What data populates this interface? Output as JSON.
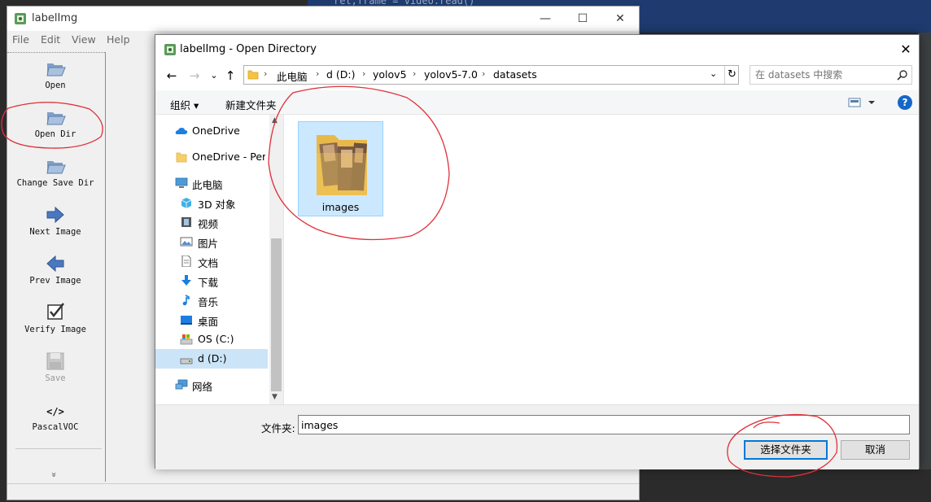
{
  "background": {
    "code_line": "ret,frame = video.read()"
  },
  "main_window": {
    "title": "labelImg",
    "controls": {
      "minimize": "—",
      "maximize": "☐",
      "close": "✕"
    },
    "menu": [
      "File",
      "Edit",
      "View",
      "Help"
    ],
    "toolbar": [
      {
        "label": "Open",
        "icon": "folder-open-icon"
      },
      {
        "label": "Open Dir",
        "icon": "folder-open-icon"
      },
      {
        "label": "Change Save Dir",
        "icon": "folder-open-icon"
      },
      {
        "label": "Next Image",
        "icon": "arrow-right-icon"
      },
      {
        "label": "Prev Image",
        "icon": "arrow-left-icon"
      },
      {
        "label": "Verify Image",
        "icon": "checkbox-icon"
      },
      {
        "label": "Save",
        "icon": "floppy-icon"
      },
      {
        "label": "PascalVOC",
        "icon": "code-icon"
      }
    ],
    "toolbar_expand": "»"
  },
  "dialog": {
    "title": "labelImg - Open Directory",
    "close": "✕",
    "nav": {
      "back": "←",
      "forward": "→",
      "recent": "⌄",
      "up": "↑"
    },
    "breadcrumb": [
      "此电脑",
      "d (D:)",
      "yolov5",
      "yolov5-7.0",
      "datasets"
    ],
    "breadcrumb_sep": "›",
    "address_dropdown": "⌄",
    "refresh": "↻",
    "search_placeholder": "在 datasets 中搜索",
    "commands": {
      "organize": "组织 ▾",
      "new_folder": "新建文件夹",
      "help": "?"
    },
    "nav_pane": [
      {
        "label": "OneDrive",
        "icon": "cloud-icon",
        "level": 1
      },
      {
        "label": "OneDrive - Personal",
        "icon": "folder-icon",
        "level": 1
      },
      {
        "label": "此电脑",
        "icon": "computer-icon",
        "level": 1
      },
      {
        "label": "3D 对象",
        "icon": "cube-icon",
        "level": 2
      },
      {
        "label": "视频",
        "icon": "film-icon",
        "level": 2
      },
      {
        "label": "图片",
        "icon": "picture-icon",
        "level": 2
      },
      {
        "label": "文档",
        "icon": "document-icon",
        "level": 2
      },
      {
        "label": "下载",
        "icon": "download-icon",
        "level": 2
      },
      {
        "label": "音乐",
        "icon": "music-icon",
        "level": 2
      },
      {
        "label": "桌面",
        "icon": "desktop-icon",
        "level": 2
      },
      {
        "label": "OS (C:)",
        "icon": "drive-c-icon",
        "level": 2
      },
      {
        "label": "d (D:)",
        "icon": "drive-d-icon",
        "level": 2,
        "selected": true
      },
      {
        "label": "网络",
        "icon": "network-icon",
        "level": 1
      }
    ],
    "files": [
      {
        "name": "images",
        "icon": "image-folder-icon",
        "selected": true
      }
    ],
    "folder_label": "文件夹:",
    "folder_value": "images",
    "select_button": "选择文件夹",
    "cancel_button": "取消"
  },
  "colors": {
    "annotation": "#e0303a",
    "selection": "#cce8ff",
    "accent": "#0078d7"
  }
}
